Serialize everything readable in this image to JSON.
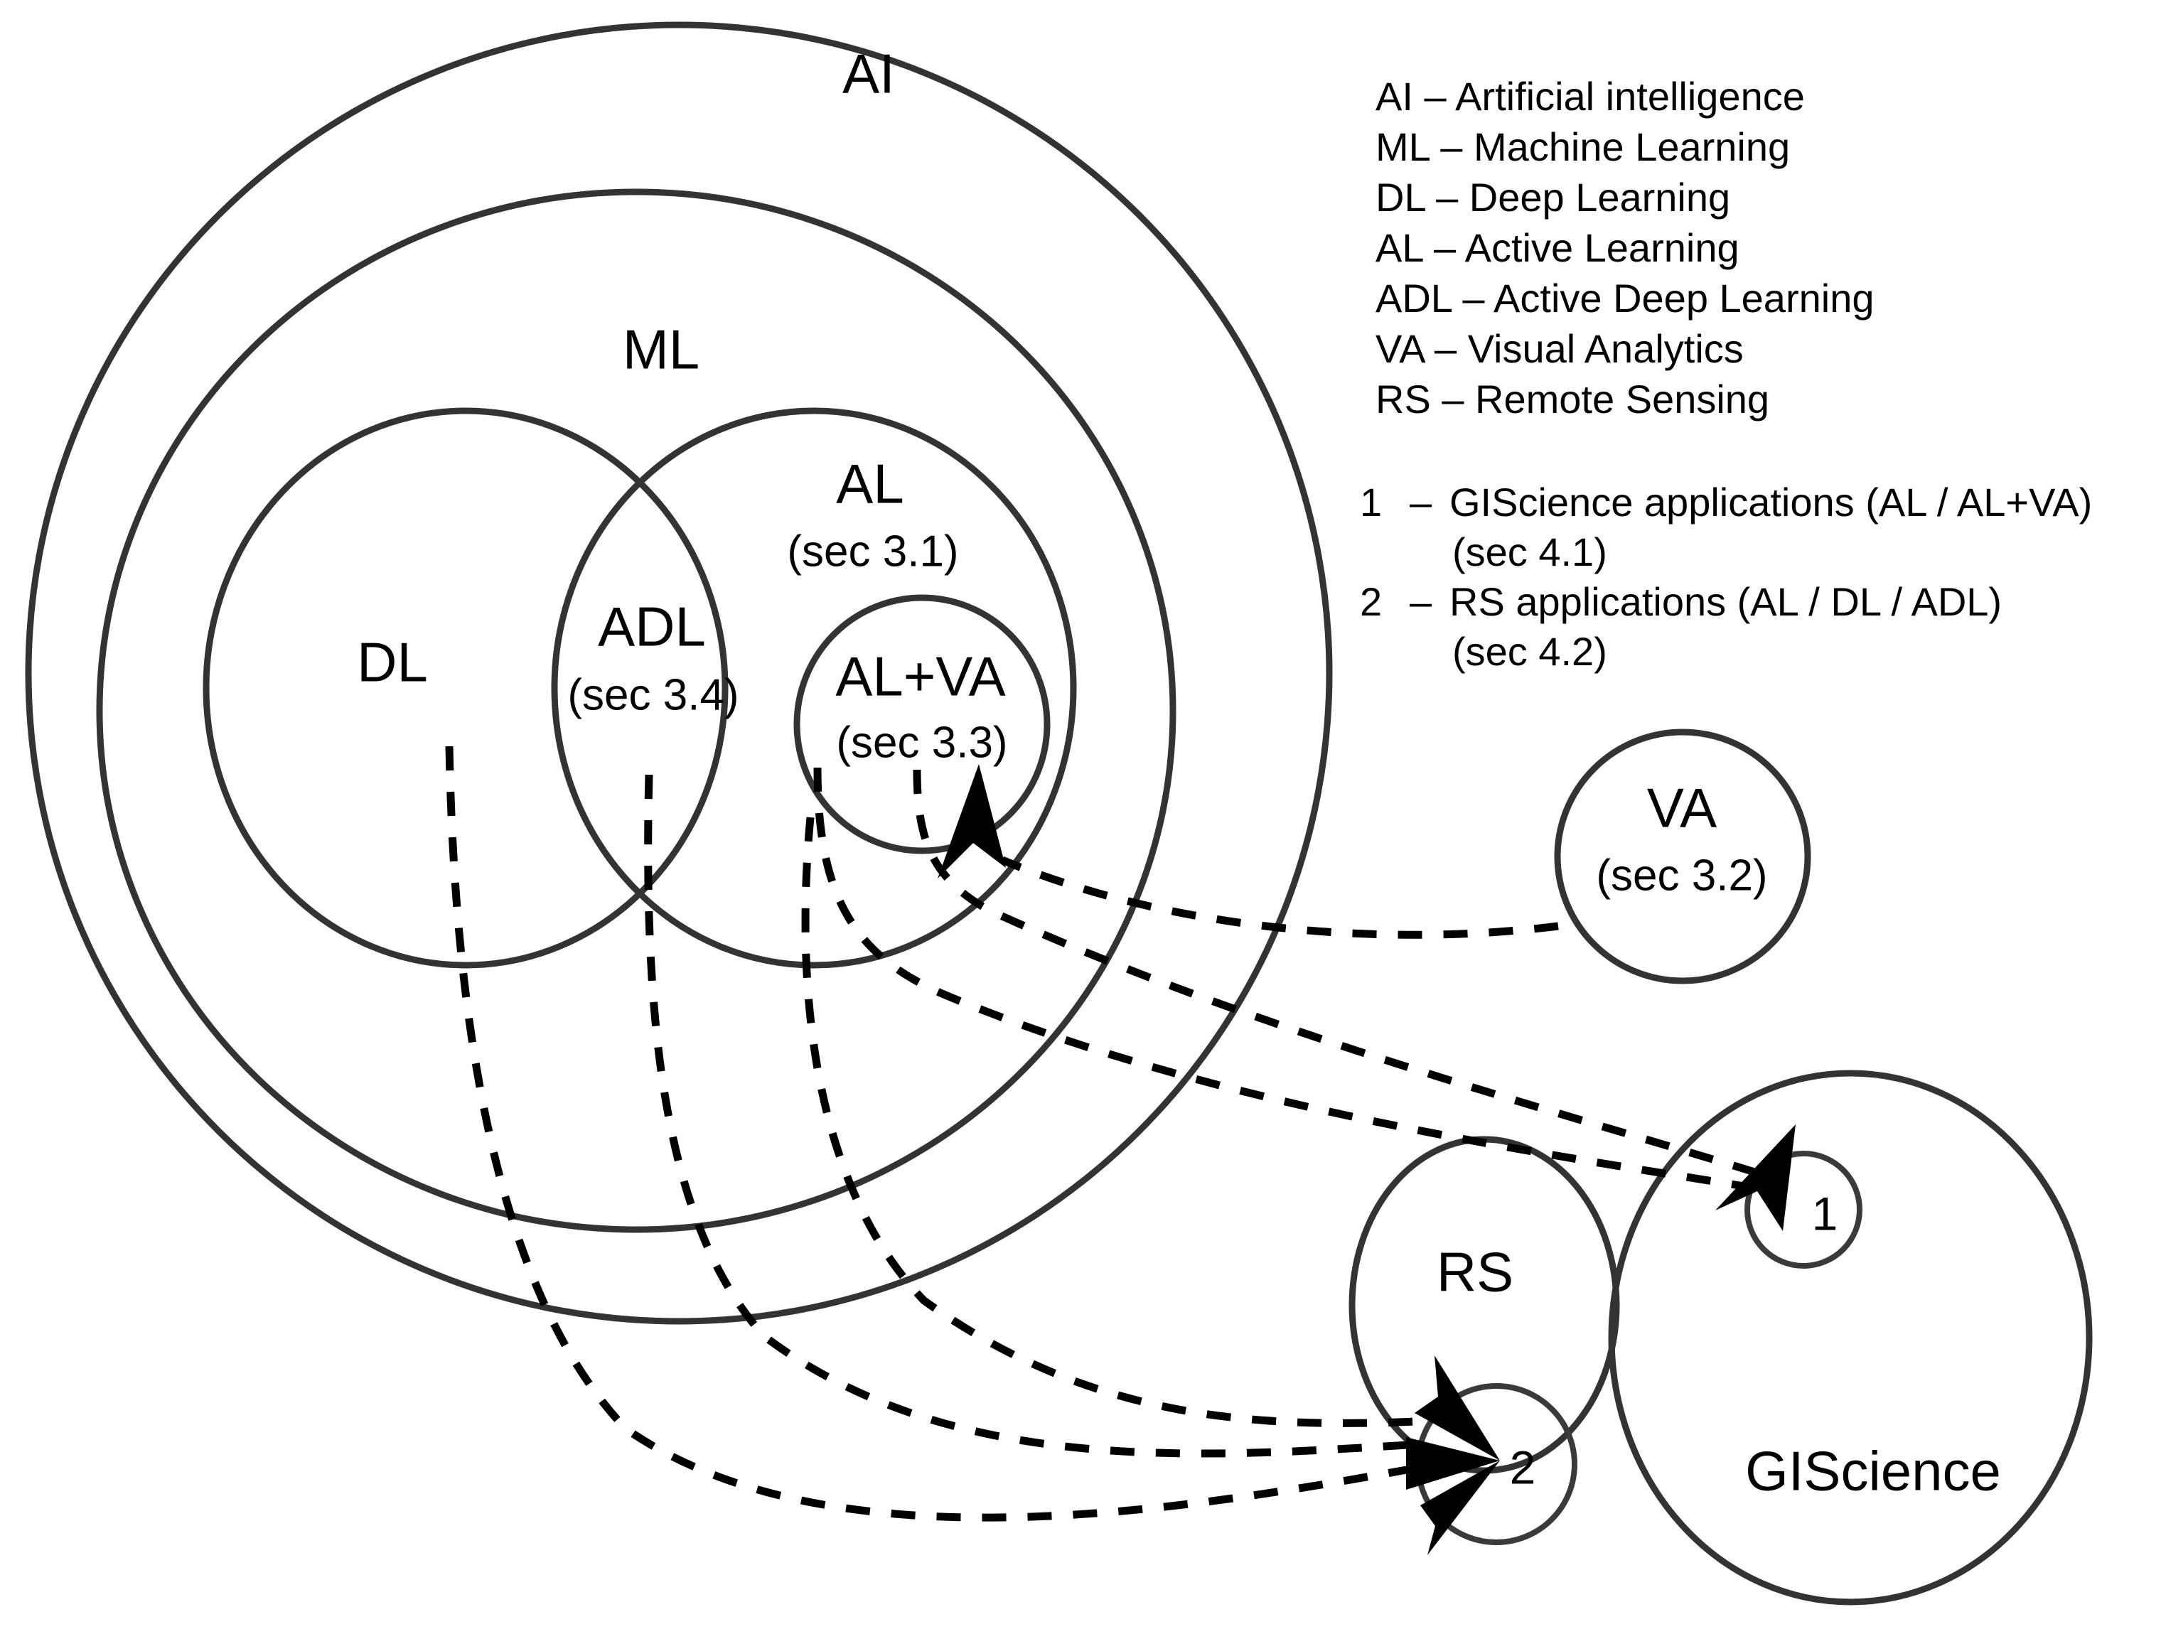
{
  "diagram": {
    "title": "AI / ML / DL / AL Venn diagram with RS and GIScience applications",
    "stroke_color": "#333333",
    "link_color": "#000000",
    "background": "#ffffff"
  },
  "sets": {
    "ai": {
      "label": "AI"
    },
    "ml": {
      "label": "ML"
    },
    "dl": {
      "label": "DL"
    },
    "al": {
      "label": "AL",
      "section": "(sec 3.1)"
    },
    "adl": {
      "label": "ADL",
      "section": "(sec 3.4)"
    },
    "alva": {
      "label": "AL+VA",
      "section": "(sec 3.3)"
    },
    "va": {
      "label": "VA",
      "section": "(sec 3.2)"
    },
    "rs": {
      "label": "RS"
    },
    "giscience": {
      "label": "GIScience"
    }
  },
  "markers": {
    "one": {
      "label": "1"
    },
    "two": {
      "label": "2"
    }
  },
  "legend": {
    "items": [
      {
        "abbr": "AI",
        "dash": "–",
        "text": "Artificial intelligence",
        "line": "AI – Artificial intelligence"
      },
      {
        "abbr": "ML",
        "dash": "–",
        "text": "Machine Learning",
        "line": "ML – Machine Learning"
      },
      {
        "abbr": "DL",
        "dash": "–",
        "text": "Deep Learning",
        "line": "DL – Deep Learning"
      },
      {
        "abbr": "AL",
        "dash": "–",
        "text": "Active Learning",
        "line": "AL – Active Learning"
      },
      {
        "abbr": "ADL",
        "dash": "–",
        "text": "Active Deep Learning",
        "line": "ADL – Active Deep Learning"
      },
      {
        "abbr": "VA",
        "dash": "–",
        "text": "Visual Analytics",
        "line": "VA – Visual Analytics"
      },
      {
        "abbr": "RS",
        "dash": "–",
        "text": "Remote Sensing",
        "line": "RS – Remote Sensing"
      }
    ]
  },
  "notes": {
    "items": [
      {
        "num": "1",
        "dash": "–",
        "text": "GIScience applications (AL / AL+VA)",
        "sub": "(sec 4.1)"
      },
      {
        "num": "2",
        "dash": "–",
        "text": " RS applications (AL / DL / ADL)",
        "sub": "(sec 4.2)"
      }
    ]
  }
}
